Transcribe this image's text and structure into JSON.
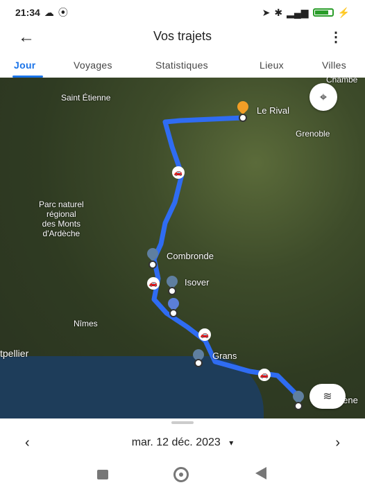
{
  "status": {
    "time": "21:34",
    "icons_left": [
      "cloud-icon",
      "sync-icon"
    ],
    "icons_right": [
      "location-arrow-icon",
      "bluetooth-icon",
      "signal-icon",
      "battery-icon"
    ],
    "battery_color": "#2a9d2a"
  },
  "appbar": {
    "title": "Vos trajets",
    "back_icon": "arrow-left-icon",
    "menu_icon": "more-vertical-icon"
  },
  "tabs": [
    {
      "label": "Jour"
    },
    {
      "label": "Voyages"
    },
    {
      "label": "Statistiques"
    },
    {
      "label": "Lieux"
    },
    {
      "label": "Villes"
    }
  ],
  "accent_color": "#1a73e8",
  "map": {
    "labels": {
      "saint_etienne": "Saint Étienne",
      "grenoble": "Grenoble",
      "parc": "Parc naturel\nrégional\ndes Monts\nd'Ardèche",
      "nimes": "Nîmes",
      "montpellier": "tpellier",
      "chambery": "Chambé",
      "marseille": "igene"
    },
    "places": {
      "le_rival": "Le Rival",
      "combronde": "Combronde",
      "isover": "Isover",
      "grans": "Grans"
    },
    "route_color": "#2f6cf2"
  },
  "sheet": {
    "date": "mar. 12 déc. 2023",
    "prev_icon": "chevron-left-icon",
    "next_icon": "chevron-right-icon",
    "dropdown_icon": "caret-down-icon"
  }
}
